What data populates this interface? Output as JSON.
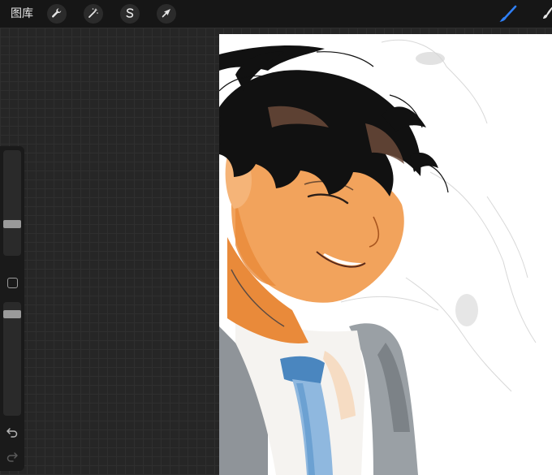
{
  "toolbar": {
    "gallery_label": "图库",
    "actions_icon": "wrench-icon",
    "adjustments_icon": "magic-wand-icon",
    "selection_icon": "selection-s-icon",
    "transform_icon": "arrow-cursor-icon",
    "brush_icon": "brush-icon",
    "smudge_icon": "smudge-icon",
    "active_tool_color": "#2f7ff5"
  },
  "sidebar": {
    "brush_size_level": 0.55,
    "opacity_level": 0.15,
    "modify_icon": "square-icon",
    "undo_icon": "undo-icon",
    "redo_icon": "redo-icon"
  },
  "canvas": {
    "artwork": "painting",
    "colors": {
      "hair": "#111111",
      "skin": "#f2a35c",
      "skin_shadow": "#e98a3a",
      "jacket": "#8f9499",
      "tie": "#4a86bf",
      "tie_light": "#8fb8df"
    }
  }
}
